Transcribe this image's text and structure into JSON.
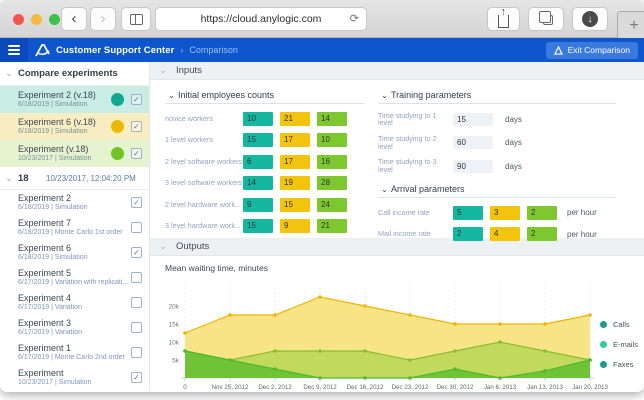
{
  "browser": {
    "url": "https://cloud.anylogic.com",
    "traffic_lights": [
      "#f2564d",
      "#f6b93f",
      "#39c24a"
    ],
    "icons": [
      "back-arrow",
      "forward-arrow",
      "sidebar-toggle",
      "reload",
      "share",
      "tabs",
      "download",
      "new-tab"
    ]
  },
  "appbar": {
    "color": "#0d56cd",
    "title": "Customer Support Center",
    "breadcrumb": {
      "separator": "›",
      "label": "Comparison"
    },
    "exit_label": "Exit Comparison"
  },
  "sidebar": {
    "header": "Compare experiments",
    "selected": [
      {
        "name": "Experiment 2 (v.18)",
        "meta": "6/18/2019 | Simulation",
        "color": "#0fa990",
        "bg": "#c9ede4",
        "checked": true
      },
      {
        "name": "Experiment 6 (v.18)",
        "meta": "6/18/2019 | Simulation",
        "color": "#edb800",
        "bg": "#f9eec2",
        "checked": true
      },
      {
        "name": "Experiment (v.18)",
        "meta": "10/23/2017 | Simulation",
        "color": "#74c324",
        "bg": "#e6f3d1",
        "checked": true
      }
    ],
    "group": {
      "id": "18",
      "timestamp": "10/23/2017, 12:04:20 PM"
    },
    "items": [
      {
        "name": "Experiment 2",
        "meta": "6/18/2019 | Simulation",
        "checked": true
      },
      {
        "name": "Experiment 7",
        "meta": "6/18/2019 | Monte Carlo 1st order",
        "checked": false
      },
      {
        "name": "Experiment 6",
        "meta": "6/18/2019 | Simulation",
        "checked": true
      },
      {
        "name": "Experiment 5",
        "meta": "6/17/2019 | Variation with replicati...",
        "checked": false
      },
      {
        "name": "Experiment 4",
        "meta": "6/17/2019 | Variation",
        "checked": false
      },
      {
        "name": "Experiment 3",
        "meta": "6/17/2019 | Variation",
        "checked": false
      },
      {
        "name": "Experiment 1",
        "meta": "6/17/2019 | Monte Carlo 2nd order",
        "checked": false
      },
      {
        "name": "Experiment",
        "meta": "10/23/2017 | Simulation",
        "checked": true
      }
    ]
  },
  "inputs": {
    "section_title": "Inputs",
    "chip_colors": [
      "#14b8a0",
      "#f2c40d",
      "#7cc82e"
    ],
    "employees": {
      "title": "Initial employees counts",
      "rows": [
        {
          "label": "novice workers",
          "values": [
            10,
            21,
            14
          ]
        },
        {
          "label": "1 level workers",
          "values": [
            15,
            17,
            10
          ]
        },
        {
          "label": "2 level software workers",
          "values": [
            6,
            17,
            16
          ]
        },
        {
          "label": "3 level software workers",
          "values": [
            14,
            19,
            28
          ]
        },
        {
          "label": "2 level hardware work...",
          "values": [
            9,
            15,
            24
          ]
        },
        {
          "label": "3 level hardware work...",
          "values": [
            15,
            9,
            21
          ]
        }
      ]
    },
    "training": {
      "title": "Training parameters",
      "unit": "days",
      "rows": [
        {
          "label": "Time studying to 1 level",
          "value": 15
        },
        {
          "label": "Time studying to 2 level",
          "value": 60
        },
        {
          "label": "Time studying to 3 level",
          "value": 90
        }
      ]
    },
    "arrival": {
      "title": "Arrival parameters",
      "unit": "per hour",
      "rows": [
        {
          "label": "Call income rate",
          "values": [
            5,
            3,
            2
          ]
        },
        {
          "label": "Mail income rate",
          "values": [
            2,
            4,
            2
          ]
        }
      ]
    }
  },
  "outputs": {
    "section_title": "Outputs",
    "chart_title": "Mean waiting time, minutes"
  },
  "chart_data": {
    "type": "area",
    "title": "Mean waiting time, minutes",
    "x": [
      "0",
      "Nov 25, 2012",
      "Dec 2, 2012",
      "Dec 9, 2012",
      "Dec 16, 2012",
      "Dec 23, 2012",
      "Dec 30, 2012",
      "Jan 6, 2013",
      "Jan 13, 2013",
      "Jan 20, 2013"
    ],
    "ylim": [
      0,
      25000
    ],
    "yticks": [
      "5k",
      "10k",
      "15k",
      "20k"
    ],
    "grid": "vertical-dotted",
    "legend_position": "right",
    "series": [
      {
        "name": "Calls",
        "values": [
          12500,
          17500,
          17500,
          22500,
          20000,
          17500,
          15000,
          15000,
          15000,
          17500
        ],
        "line": "#f0b400",
        "fill": "#f6e27c",
        "legend_dot": "#1b9c8e"
      },
      {
        "name": "E-mails",
        "values": [
          7500,
          5000,
          7500,
          7500,
          7500,
          5000,
          7500,
          10000,
          7500,
          5000
        ],
        "line": "#8abf2c",
        "fill": "#bcd95b",
        "legend_dot": "#2fcb9c"
      },
      {
        "name": "Faxes",
        "values": [
          7500,
          5000,
          2500,
          0,
          0,
          0,
          2500,
          0,
          2000,
          5000
        ],
        "line": "#4fb92f",
        "fill": "#67c233",
        "legend_dot": "#1b9c8e"
      }
    ]
  }
}
